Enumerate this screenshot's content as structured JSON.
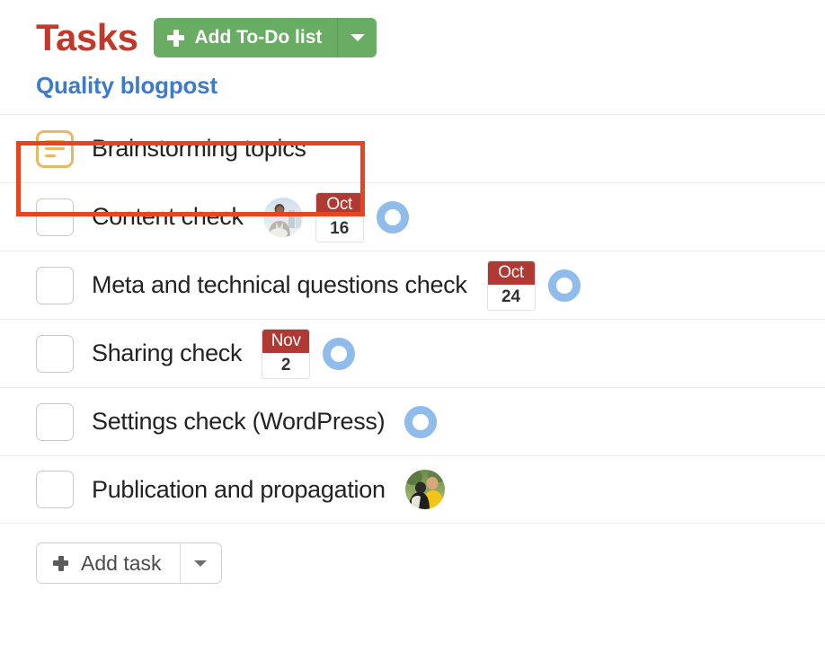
{
  "header": {
    "title": "Tasks",
    "add_list_button": {
      "label": "Add To-Do list",
      "icon": "plus-icon",
      "caret_icon": "chevron-down-icon",
      "color": "#68ad63"
    }
  },
  "list": {
    "name": "Quality blogpost",
    "name_color": "#3d7ac9"
  },
  "highlight": {
    "color": "#e8441d"
  },
  "tasks": [
    {
      "title": "Brainstorming topics",
      "leading_icon": "document-lines-icon",
      "leading_icon_color": "#e8b862",
      "has_checkbox": false,
      "highlighted": true,
      "avatar": null,
      "date": null,
      "ring": false
    },
    {
      "title": "Content check",
      "leading_icon": "checkbox-empty-icon",
      "has_checkbox": true,
      "highlighted": false,
      "avatar": "person-at-desk-avatar",
      "date": {
        "month": "Oct",
        "day": "16"
      },
      "ring": true
    },
    {
      "title": "Meta and technical questions check",
      "leading_icon": "checkbox-empty-icon",
      "has_checkbox": true,
      "highlighted": false,
      "avatar": null,
      "date": {
        "month": "Oct",
        "day": "24"
      },
      "ring": true
    },
    {
      "title": "Sharing check",
      "leading_icon": "checkbox-empty-icon",
      "has_checkbox": true,
      "highlighted": false,
      "avatar": null,
      "date": {
        "month": "Nov",
        "day": "2"
      },
      "ring": true
    },
    {
      "title": "Settings check (WordPress)",
      "leading_icon": "checkbox-empty-icon",
      "has_checkbox": true,
      "highlighted": false,
      "avatar": null,
      "date": null,
      "ring": true
    },
    {
      "title": "Publication and propagation",
      "leading_icon": "checkbox-empty-icon",
      "has_checkbox": true,
      "highlighted": false,
      "avatar": "person-outdoors-avatar",
      "date": null,
      "ring": false
    }
  ],
  "footer": {
    "add_task_button": {
      "label": "Add task",
      "icon": "plus-icon",
      "caret_icon": "chevron-down-icon"
    }
  },
  "colors": {
    "ring": "#8fbcea",
    "date_header": "#b03a33",
    "title": "#c0392b"
  }
}
